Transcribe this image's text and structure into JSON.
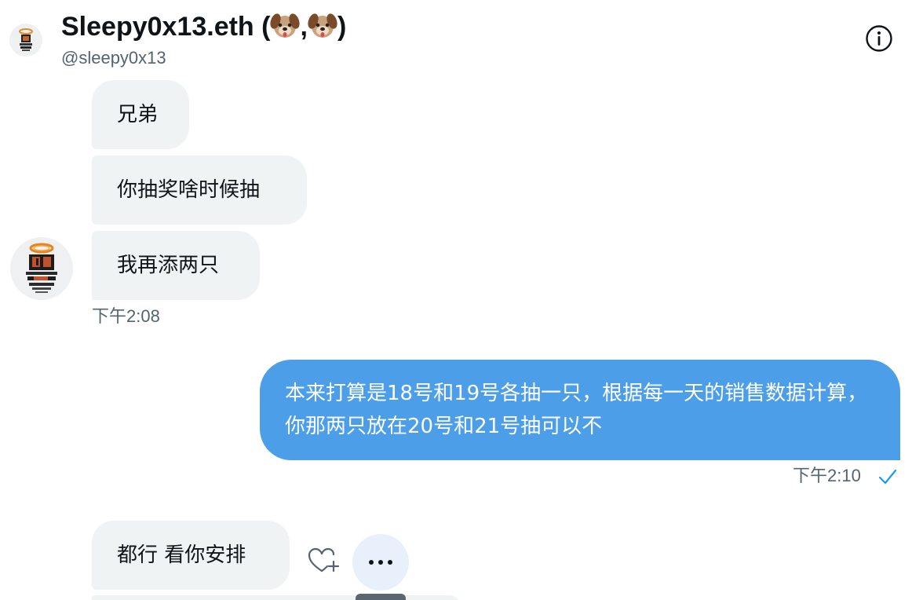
{
  "header": {
    "name": "Sleepy0x13.eth (",
    "name_sep": ",",
    "name_close": ")",
    "handle": "@sleepy0x13",
    "emoji_icon": "dog-face-icon",
    "info_icon": "info-icon"
  },
  "messages": [
    {
      "direction": "in",
      "text": "兄弟"
    },
    {
      "direction": "in",
      "text": "你抽奖啥时候抽"
    },
    {
      "direction": "in",
      "text": "我再添两只"
    },
    {
      "direction": "out",
      "text": "本来打算是18号和19号各抽一只，根据每一天的销售数据计算，你那两只放在20号和21号抽可以不"
    },
    {
      "direction": "in",
      "text": "都行 看你安排"
    }
  ],
  "timestamps": {
    "incoming_group": "下午2:08",
    "outgoing": "下午2:10"
  },
  "actions": {
    "react_icon": "heart-plus-icon",
    "more_icon": "more-horizontal-icon",
    "read_icon": "checkmark-icon"
  },
  "colors": {
    "outgoing_bubble": "#4c9ee8",
    "incoming_bubble": "#eff3f4",
    "secondary_text": "#536471",
    "check": "#1d9bf0"
  }
}
